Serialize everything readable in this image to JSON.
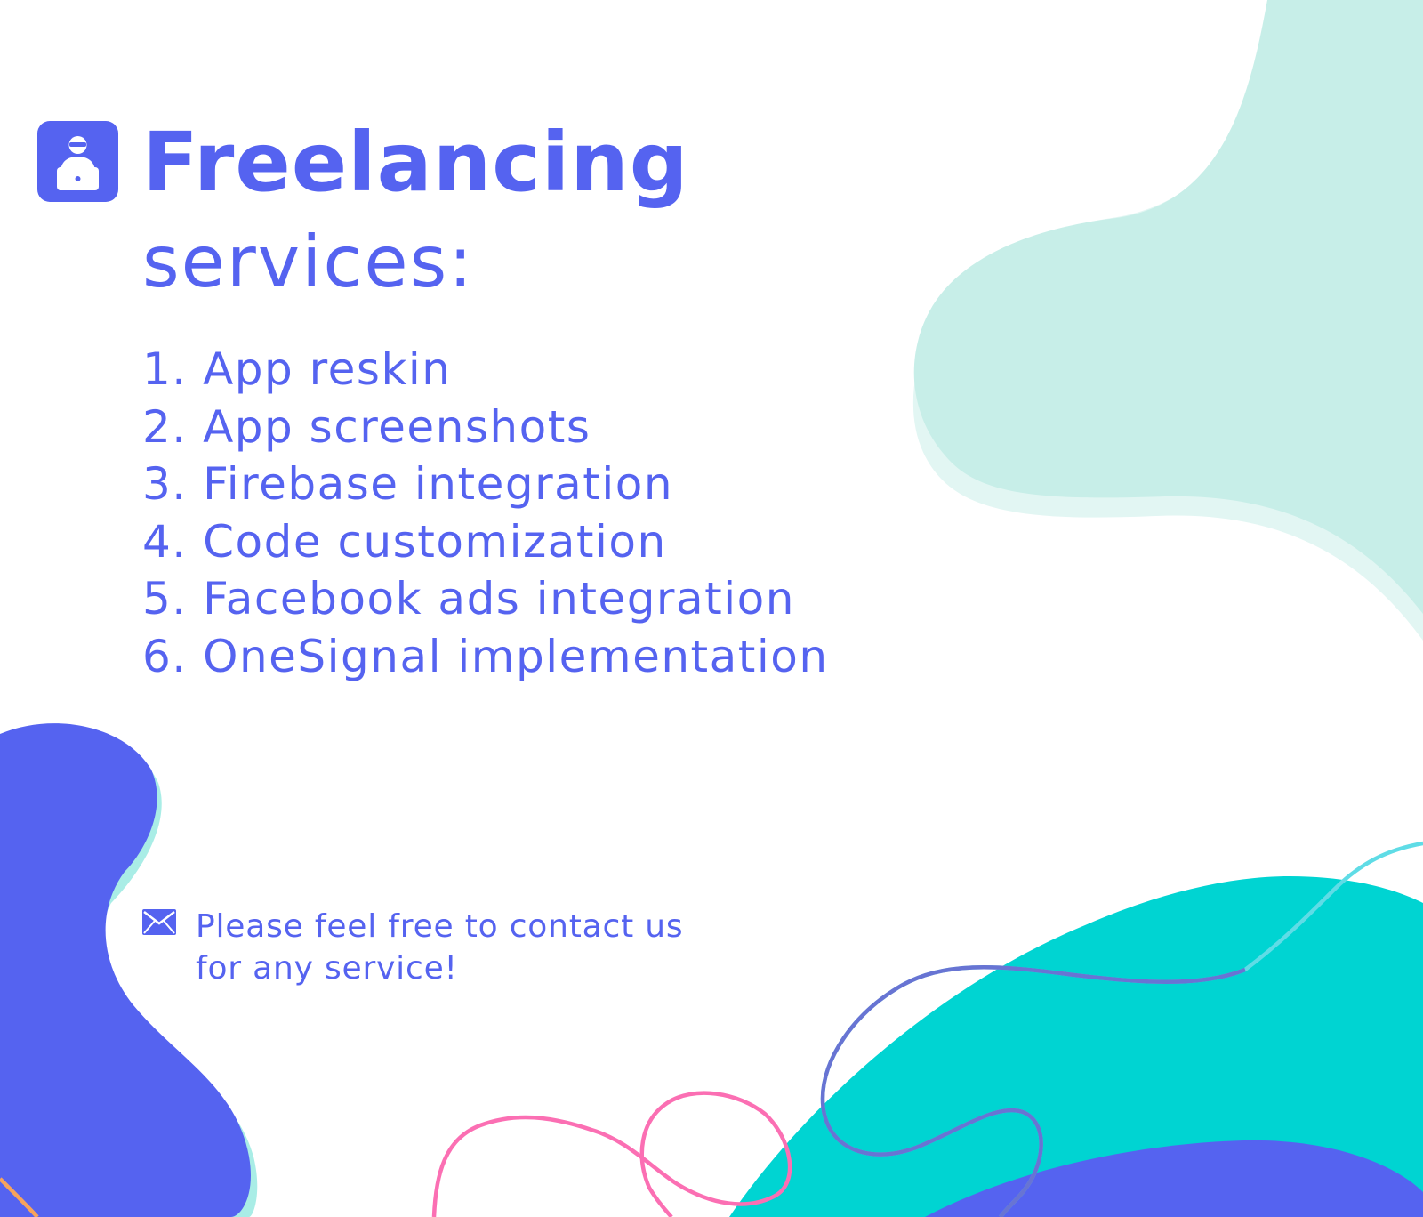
{
  "colors": {
    "brand": "#5563f0",
    "mint": "#c7eee8",
    "teal": "#00d4d2",
    "pink": "#fb6fb3",
    "cyan": "#60dde8"
  },
  "header": {
    "icon": "freelancer-laptop-icon",
    "title": "Freelancing",
    "subtitle": "services:"
  },
  "services": [
    "1. App reskin",
    "2. App screenshots",
    "3. Firebase integration",
    "4. Code customization",
    "5. Facebook ads integration",
    "6. OneSignal implementation"
  ],
  "contact": {
    "icon": "mail-icon",
    "line1": "Please feel free to contact us",
    "line2": "for any service!"
  }
}
